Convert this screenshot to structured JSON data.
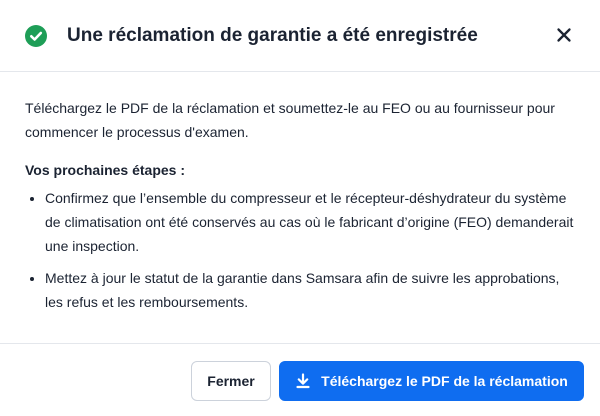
{
  "dialog": {
    "title": "Une réclamation de garantie a été enregistrée",
    "status_icon": "check-circle-icon",
    "close_icon": "close-icon",
    "intro": "Téléchargez le PDF de la réclamation et soumettez-le au FEO ou au fournisseur pour commencer le processus d'examen.",
    "steps_title": "Vos prochaines étapes :",
    "steps": [
      "Confirmez que l’ensemble du compresseur et le récepteur-déshydrateur du système de climatisation ont été conservés au cas où le fabricant d’origine (FEO) demanderait une inspection.",
      "Mettez à jour le statut de la garantie dans Samsara afin de suivre les approbations, les refus et les remboursements."
    ]
  },
  "footer": {
    "close_label": "Fermer",
    "download_label": "Téléchargez le PDF de la réclamation",
    "download_icon": "download-icon"
  },
  "colors": {
    "success": "#1e9e57",
    "primary": "#0f6df0",
    "text": "#1b2332",
    "divider": "#e4e7ec"
  }
}
